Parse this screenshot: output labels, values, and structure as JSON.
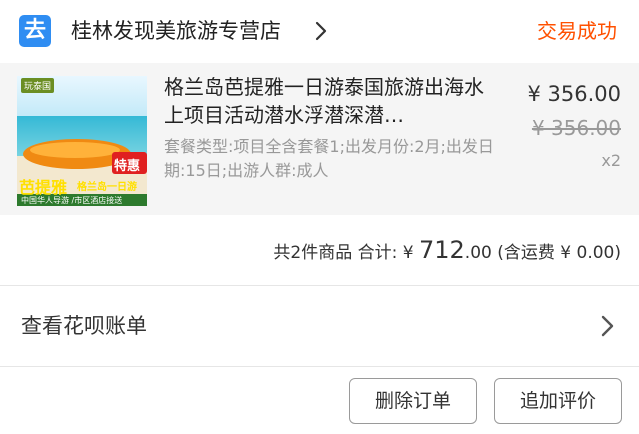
{
  "header": {
    "store_icon_glyph": "去",
    "store_name": "桂林发现美旅游专营店",
    "status": "交易成功",
    "status_color": "#ff5000"
  },
  "item": {
    "title": "格兰岛芭提雅一日游泰国旅游出海水上项目活动潜水浮潜深潜…",
    "sku": "套餐类型:项目全含套餐1;出发月份:2月;出发日期:15日;出游人群:成人",
    "price": "¥ 356.00",
    "original_price": "¥ 356.00",
    "quantity": "x2",
    "thumbnail": {
      "logo": "玩泰国",
      "badge": "特惠",
      "headline": "芭提雅",
      "subhead": "格兰岛一日游",
      "footer": "中国华人导游 /市区酒店接送"
    }
  },
  "summary": {
    "count_text": "共2件商品 合计:",
    "currency": "¥",
    "total_int": "712",
    "total_dec": ".00",
    "shipping_text": "(含运费 ¥ 0.00)"
  },
  "huabei": {
    "label": "查看花呗账单"
  },
  "actions": {
    "delete_label": "删除订单",
    "review_label": "追加评价"
  },
  "icons": {
    "store": "store-icon",
    "header_chevron": "chevron-right-icon",
    "row_chevron": "chevron-right-icon"
  }
}
